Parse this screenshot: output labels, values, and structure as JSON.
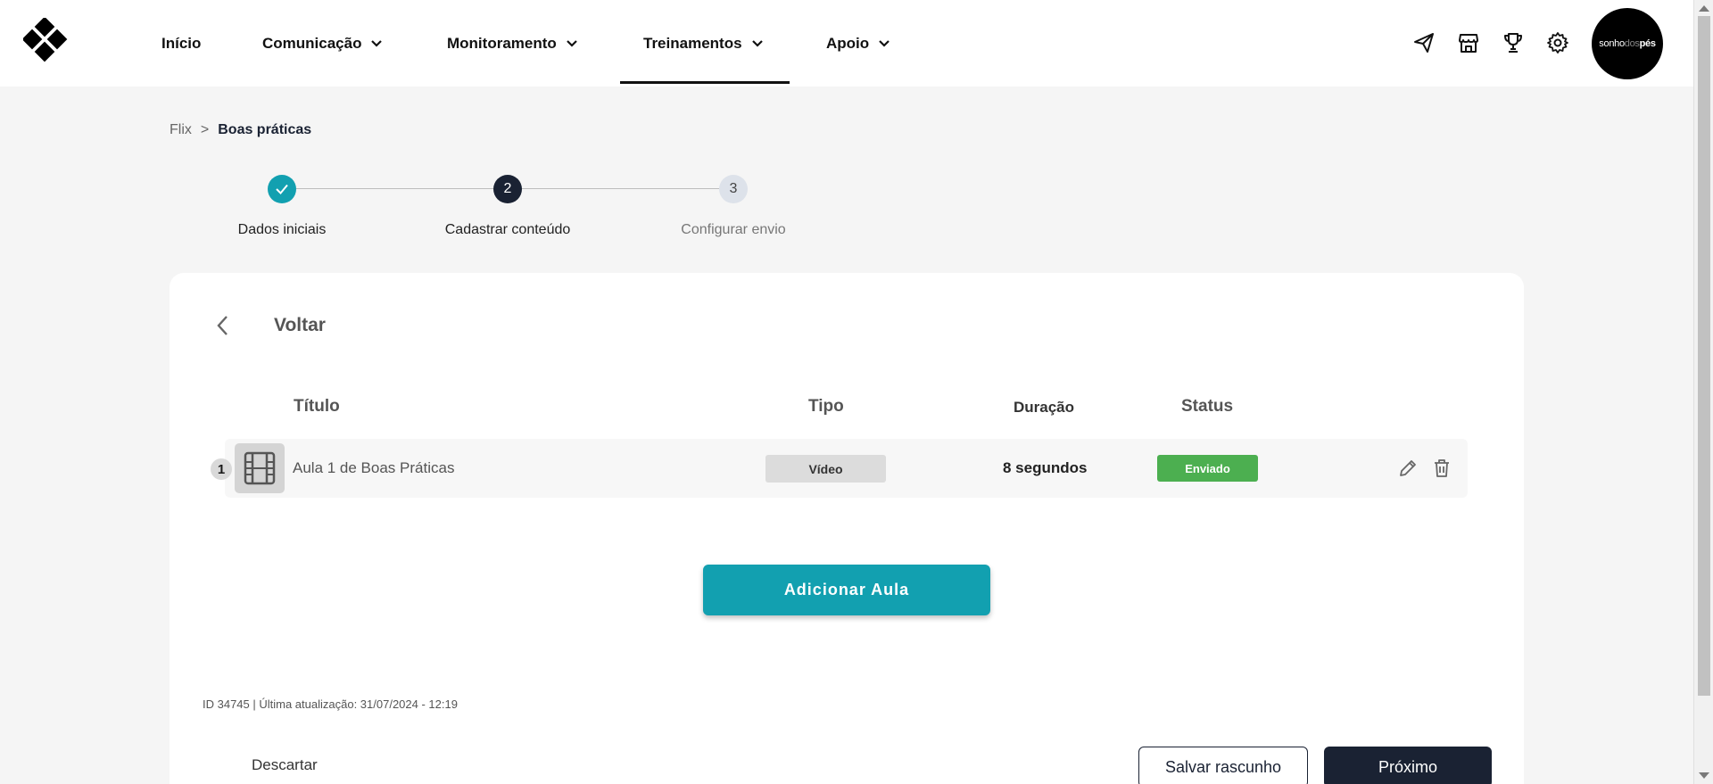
{
  "brand": {
    "logo_icon": "diamond-grid-logo"
  },
  "nav": {
    "items": [
      {
        "label": "Início",
        "has_dropdown": false
      },
      {
        "label": "Comunicação",
        "has_dropdown": true
      },
      {
        "label": "Monitoramento",
        "has_dropdown": true
      },
      {
        "label": "Treinamentos",
        "has_dropdown": true,
        "active": true
      },
      {
        "label": "Apoio",
        "has_dropdown": true
      }
    ],
    "icons": [
      "send-icon",
      "store-icon",
      "trophy-icon",
      "gear-icon"
    ],
    "avatar": {
      "part1": "sonho",
      "part2": "dos",
      "part3": "pés"
    }
  },
  "breadcrumb": {
    "parent": "Flix",
    "separator": ">",
    "current": "Boas práticas"
  },
  "stepper": {
    "steps": [
      {
        "number": "1",
        "label": "Dados iniciais",
        "state": "done"
      },
      {
        "number": "2",
        "label": "Cadastrar conteúdo",
        "state": "active"
      },
      {
        "number": "3",
        "label": "Configurar envio",
        "state": "pending"
      }
    ]
  },
  "card": {
    "back_label": "Voltar",
    "columns": {
      "title": "Título",
      "type": "Tipo",
      "duration": "Duração",
      "status": "Status"
    },
    "rows": [
      {
        "index": "1",
        "thumb_icon": "film-icon",
        "title": "Aula 1 de Boas Práticas",
        "type": "Vídeo",
        "duration": "8 segundos",
        "status": "Enviado"
      }
    ],
    "add_button": "Adicionar Aula",
    "meta": "ID 34745 | Última atualização: 31/07/2024 - 12:19"
  },
  "footer": {
    "discard": "Descartar",
    "save_draft": "Salvar rascunho",
    "next": "Próximo"
  },
  "colors": {
    "accent": "#12a0b0",
    "dark": "#1a2233",
    "success": "#4caf50"
  }
}
